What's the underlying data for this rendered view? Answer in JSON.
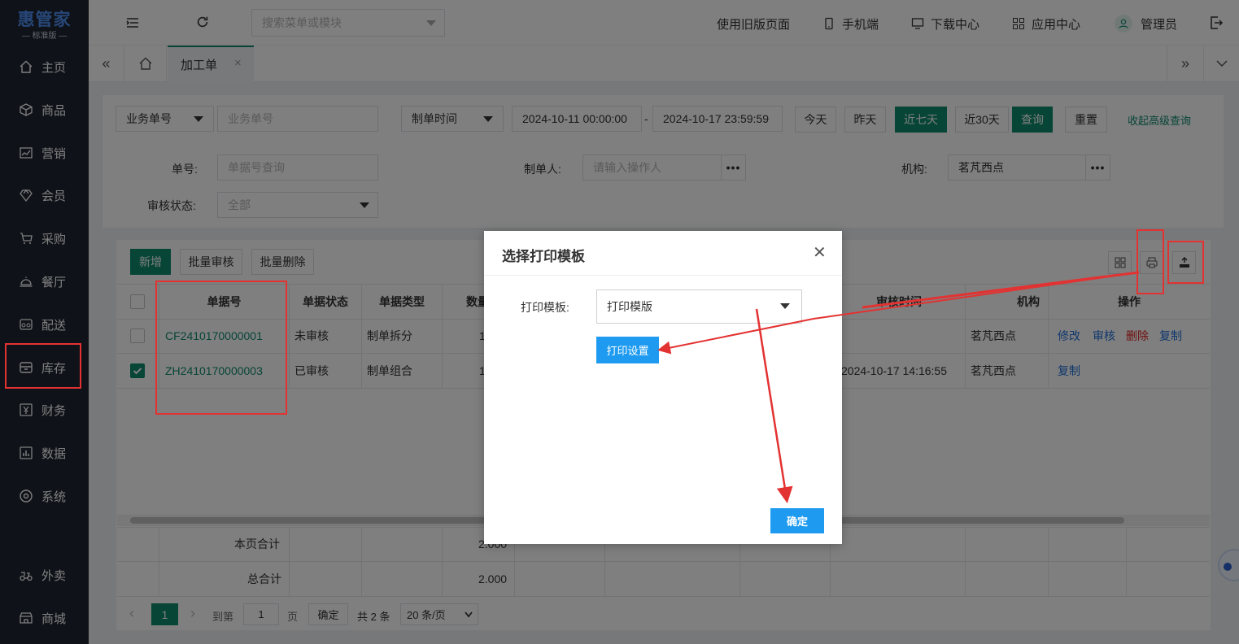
{
  "app": {
    "logo": "惠管家",
    "edition": "— 标准版 —"
  },
  "sidebar": {
    "items": [
      {
        "label": "主页",
        "icon": "home-icon"
      },
      {
        "label": "商品",
        "icon": "box-icon"
      },
      {
        "label": "营销",
        "icon": "chart-icon"
      },
      {
        "label": "会员",
        "icon": "diamond-icon"
      },
      {
        "label": "采购",
        "icon": "cart-icon"
      },
      {
        "label": "餐厅",
        "icon": "cloche-icon"
      },
      {
        "label": "配送",
        "icon": "delivery-icon"
      },
      {
        "label": "库存",
        "icon": "storage-icon"
      },
      {
        "label": "财务",
        "icon": "yen-icon"
      },
      {
        "label": "数据",
        "icon": "data-icon"
      },
      {
        "label": "系统",
        "icon": "settings-icon"
      },
      {
        "label": "外卖",
        "icon": "scooter-icon"
      },
      {
        "label": "商城",
        "icon": "shop-icon"
      }
    ]
  },
  "topbar": {
    "search_placeholder": "搜索菜单或模块",
    "old_page": "使用旧版页面",
    "mobile": "手机端",
    "download": "下载中心",
    "apps": "应用中心",
    "user": "管理员"
  },
  "tabs": {
    "active": "加工单",
    "close": "×"
  },
  "filters": {
    "field_select": "业务单号",
    "field_placeholder": "业务单号",
    "time_select": "制单时间",
    "start": "2024-10-11 00:00:00",
    "dash": "-",
    "end": "2024-10-17 23:59:59",
    "today": "今天",
    "yesterday": "昨天",
    "seven_days": "近七天",
    "thirty_days": "近30天",
    "query": "查询",
    "reset": "重置",
    "collapse": "收起高级查询",
    "order_no_label": "单号:",
    "order_no_placeholder": "单据号查询",
    "creator_label": "制单人:",
    "creator_placeholder": "请输入操作人",
    "org_label": "机构:",
    "org_value": "茗芃西点",
    "audit_label": "审核状态:",
    "audit_value": "全部",
    "more": "•••"
  },
  "toolbar": {
    "add": "新增",
    "batch_audit": "批量审核",
    "batch_delete": "批量删除"
  },
  "table": {
    "headers": {
      "no": "单据号",
      "status": "单据状态",
      "type": "单据类型",
      "qty": "数量",
      "audit_time": "审核时间",
      "org": "机构",
      "ops": "操作"
    },
    "rows": [
      {
        "no": "CF2410170000001",
        "status": "未审核",
        "type": "制单拆分",
        "qty": "1",
        "audit_time": "",
        "org": "茗芃西点",
        "checked": false,
        "ops": [
          "修改",
          "审核",
          "删除",
          "复制"
        ]
      },
      {
        "no": "ZH2410170000003",
        "status": "已审核",
        "type": "制单组合",
        "qty": "1",
        "audit_time": "2024-10-17 14:16:55",
        "org": "茗芃西点",
        "checked": true,
        "ops": [
          "复制"
        ]
      }
    ],
    "page_total_label": "本页合计",
    "page_total_qty": "2.000",
    "grand_total_label": "总合计",
    "grand_total_qty": "2.000"
  },
  "pagination": {
    "current": "1",
    "goto_label": "到第",
    "goto_value": "1",
    "page_unit": "页",
    "confirm": "确定",
    "total": "共 2 条",
    "page_size": "20 条/页"
  },
  "dialog": {
    "title": "选择打印模板",
    "close": "✕",
    "template_label": "打印模板:",
    "template_value": "打印模版",
    "settings_button": "打印设置",
    "confirm_button": "确定"
  },
  "colors": {
    "sidebar_bg": "#1f2430",
    "accent_green": "#0e8a6c",
    "dialog_blue": "#1e9bf0",
    "annotation_red": "#e33232"
  }
}
